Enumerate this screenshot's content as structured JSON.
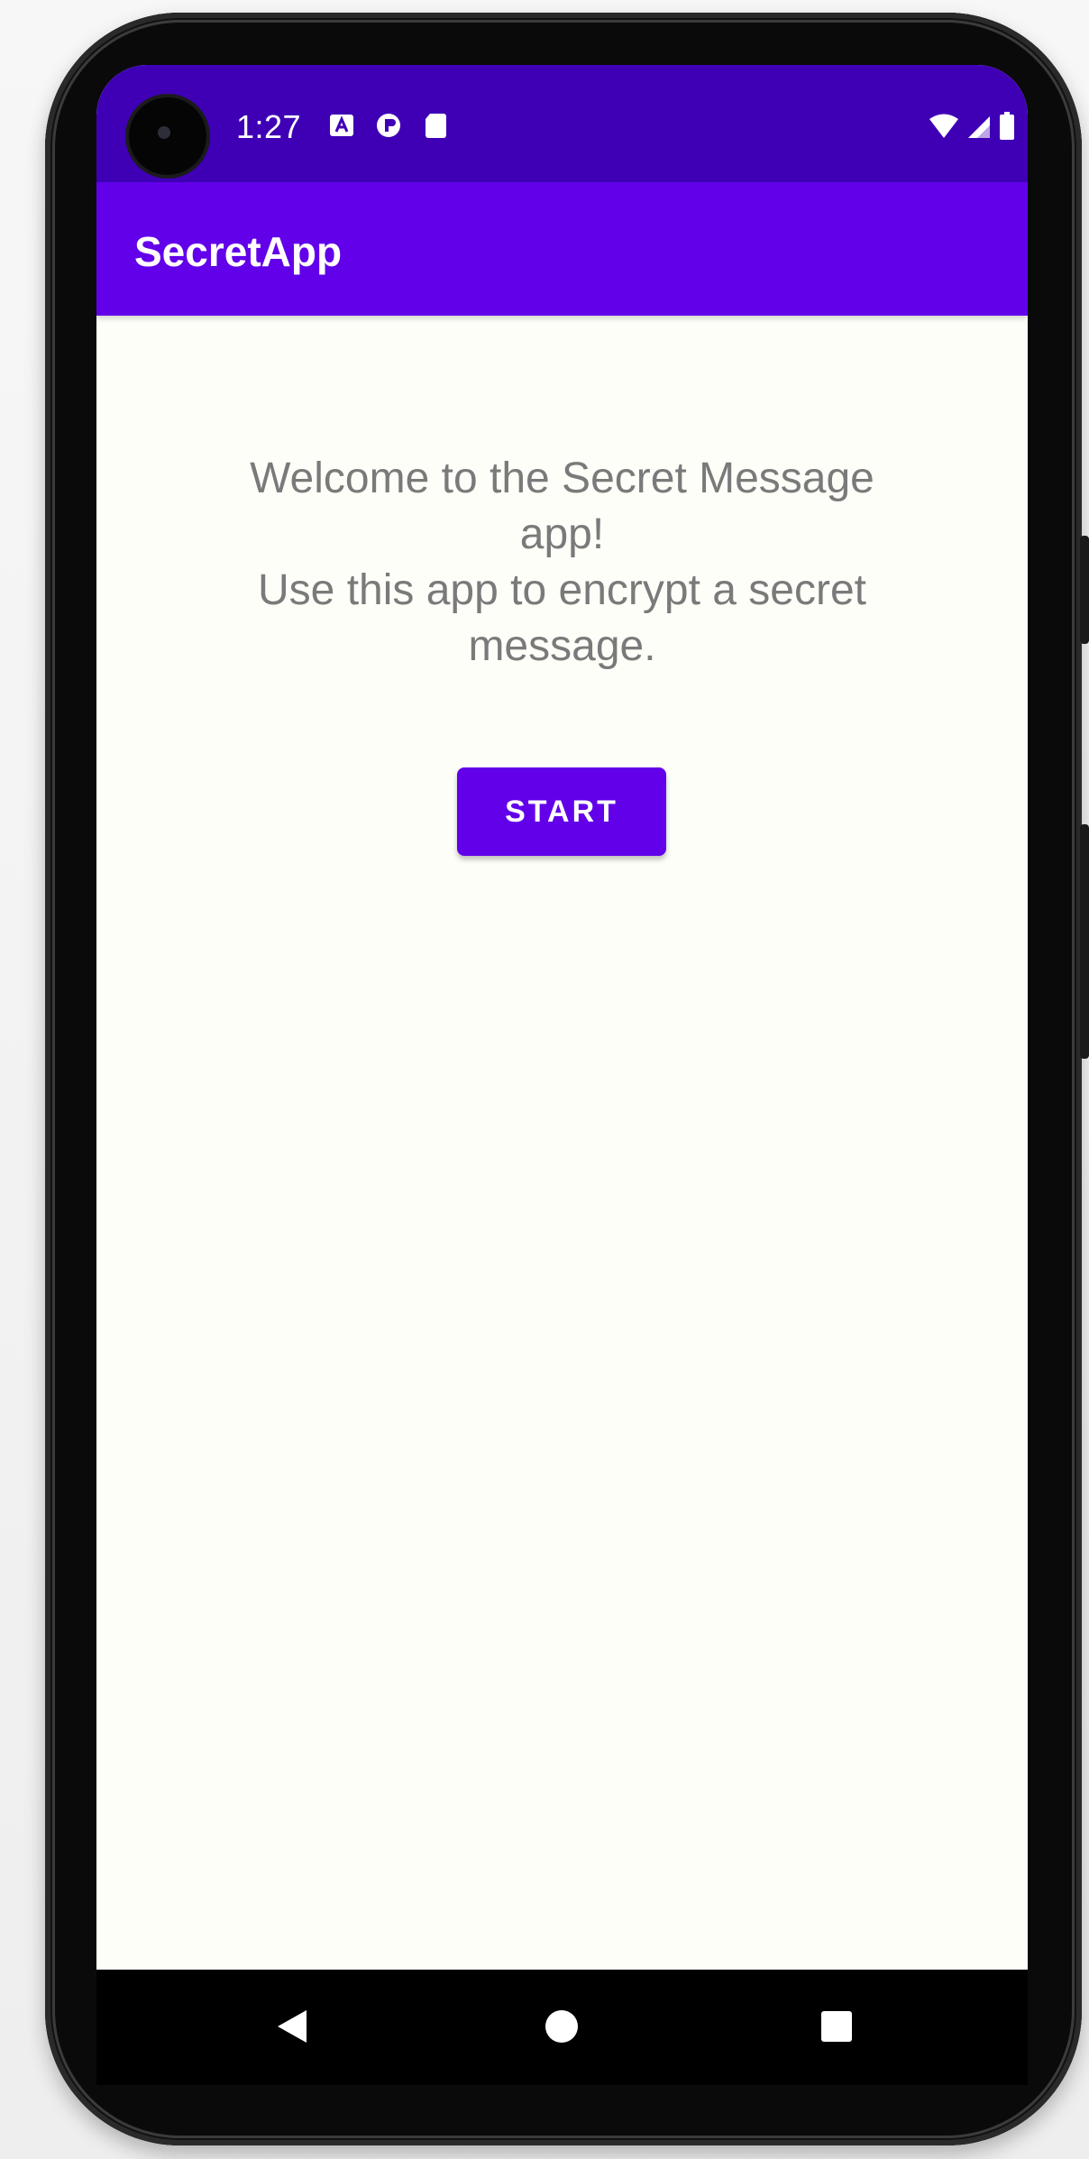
{
  "status_bar": {
    "time": "1:27",
    "icons_left": [
      "a-notification-icon",
      "record-notification-icon",
      "sd-card-icon"
    ],
    "icons_right": [
      "wifi-icon",
      "cellular-signal-icon",
      "battery-icon"
    ]
  },
  "app_bar": {
    "title": "SecretApp"
  },
  "main": {
    "welcome_text": "Welcome to the Secret Message\napp!\nUse this app to encrypt a secret\nmessage.",
    "start_label": "START"
  },
  "nav_bar": {
    "icons": [
      "back-icon",
      "home-icon",
      "recents-icon"
    ]
  },
  "colors": {
    "status_bar": "#3f00b5",
    "app_bar": "#6200ea",
    "button": "#6200ea",
    "background": "#fefef9",
    "text": "#7a7a7a"
  }
}
